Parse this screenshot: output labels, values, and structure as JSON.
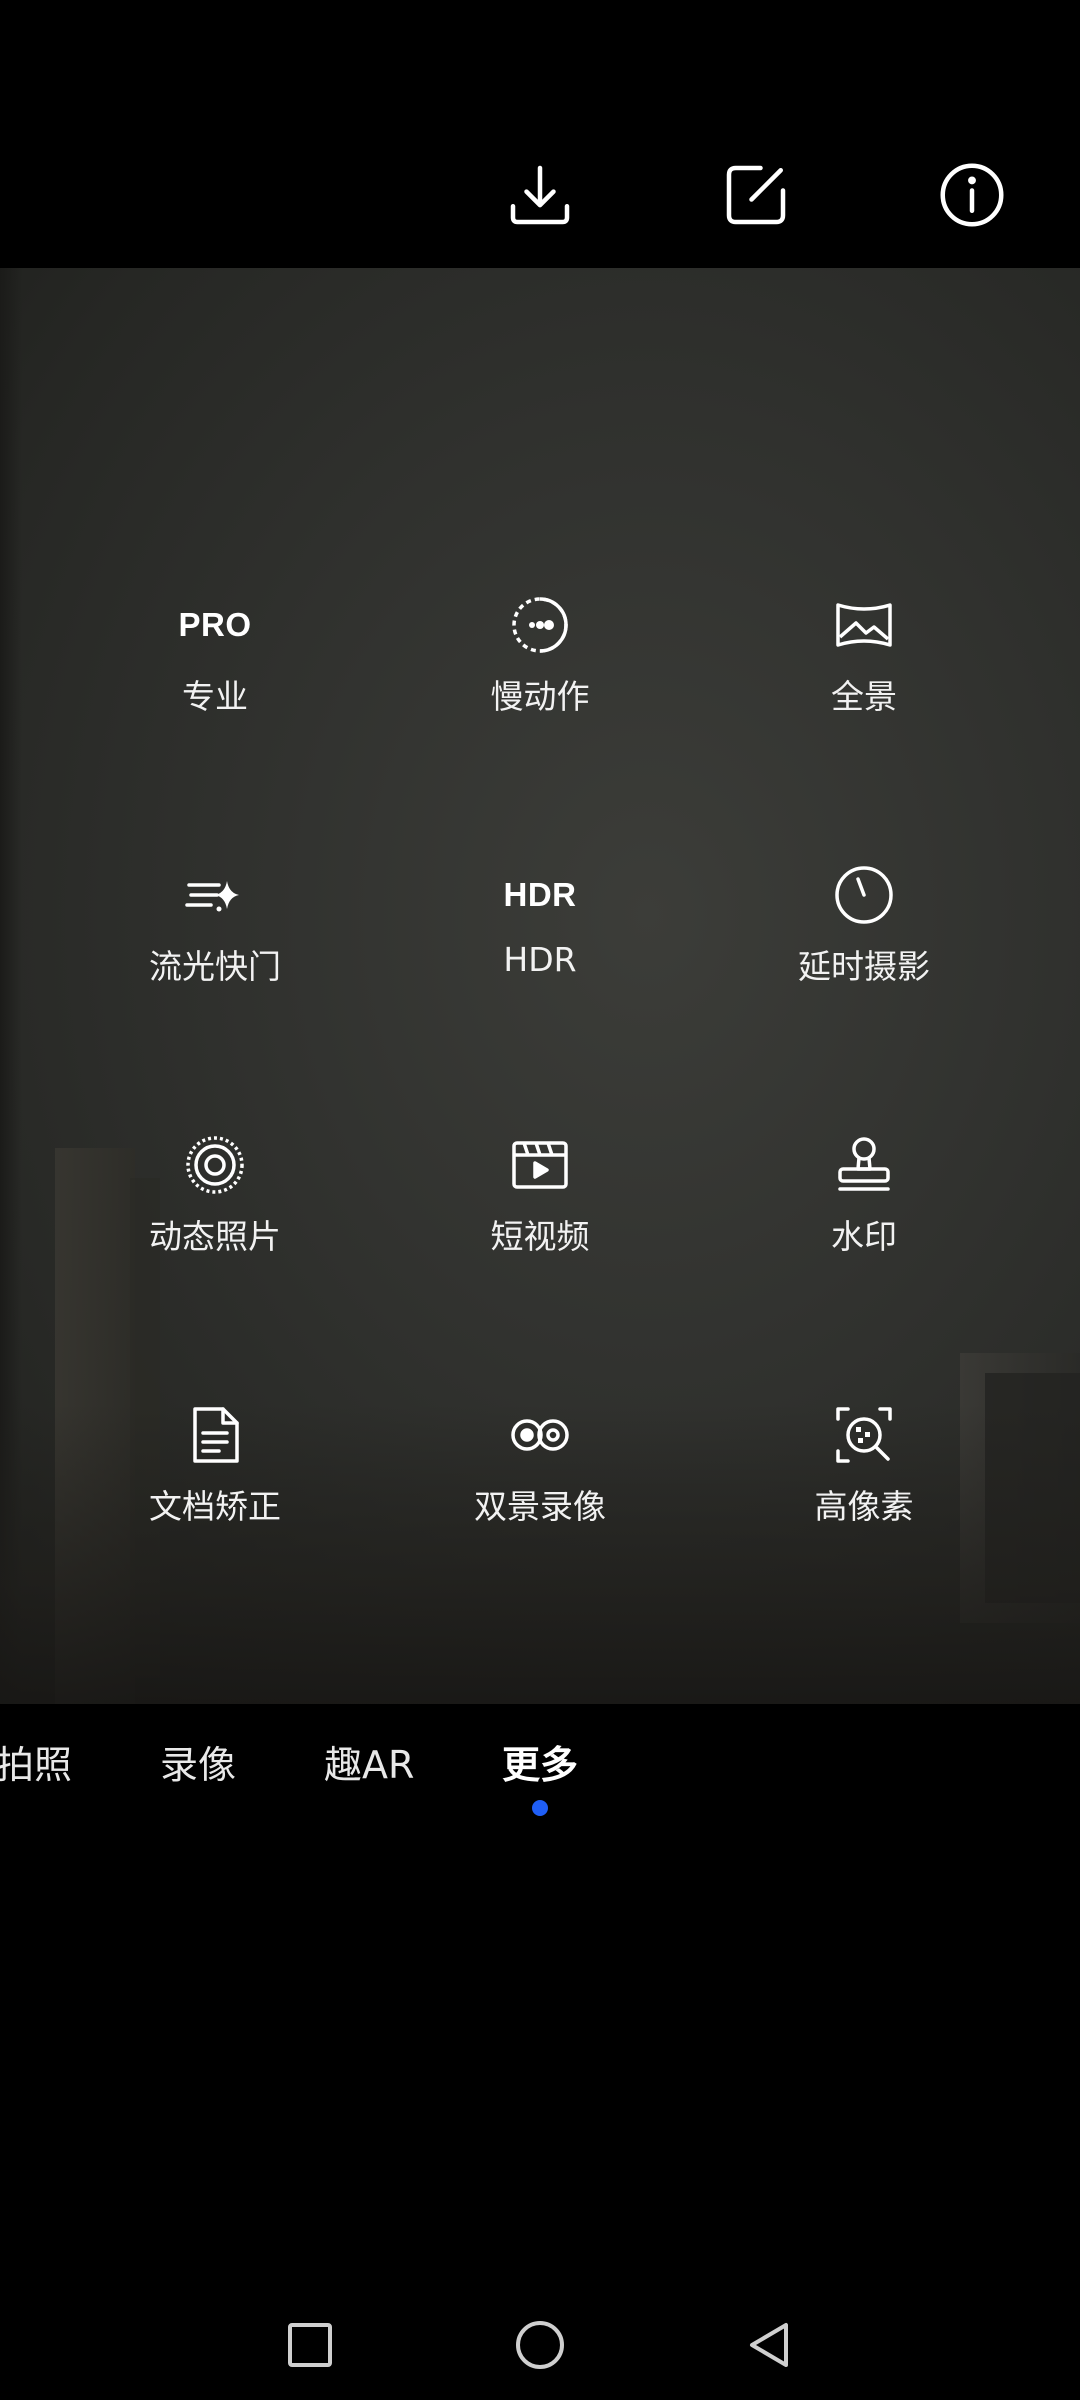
{
  "top_bar": {
    "icons": [
      "download-icon",
      "edit-icon",
      "info-icon"
    ]
  },
  "modes": [
    {
      "id": "pro",
      "icon_text": "PRO",
      "label": "专业"
    },
    {
      "id": "slow-motion",
      "icon": "slow-motion-icon",
      "label": "慢动作"
    },
    {
      "id": "panorama",
      "icon": "panorama-icon",
      "label": "全景"
    },
    {
      "id": "light-painting",
      "icon": "light-streak-icon",
      "label": "流光快门"
    },
    {
      "id": "hdr",
      "icon_text": "HDR",
      "label": "HDR"
    },
    {
      "id": "time-lapse",
      "icon": "timer-icon",
      "label": "延时摄影"
    },
    {
      "id": "moving-picture",
      "icon": "moving-picture-icon",
      "label": "动态照片"
    },
    {
      "id": "short-video",
      "icon": "short-video-icon",
      "label": "短视频"
    },
    {
      "id": "watermark",
      "icon": "stamp-icon",
      "label": "水印"
    },
    {
      "id": "document",
      "icon": "document-icon",
      "label": "文档矫正"
    },
    {
      "id": "dual-view",
      "icon": "dual-view-icon",
      "label": "双景录像"
    },
    {
      "id": "high-res",
      "icon": "high-res-icon",
      "label": "高像素"
    }
  ],
  "mode_tabs": [
    {
      "label": "拍照",
      "active": false
    },
    {
      "label": "录像",
      "active": false
    },
    {
      "label": "趣AR",
      "active": false
    },
    {
      "label": "更多",
      "active": true
    }
  ],
  "colors": {
    "active_indicator": "#1f5ef5",
    "background": "#000000"
  },
  "nav_bar": {
    "icons": [
      "recents-square-icon",
      "home-circle-icon",
      "back-triangle-icon"
    ]
  }
}
